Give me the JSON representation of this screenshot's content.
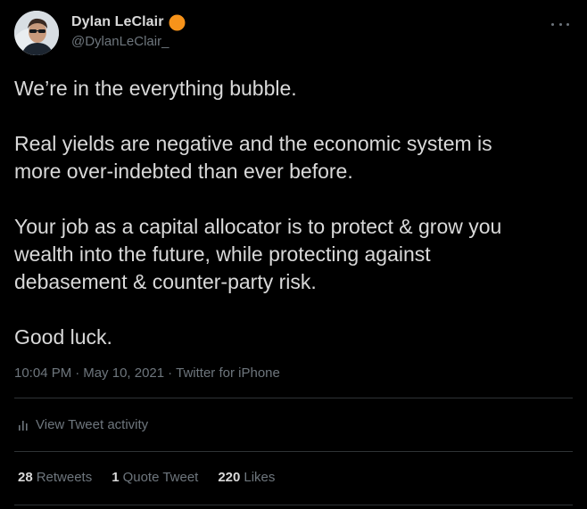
{
  "author": {
    "display_name": "Dylan LeClair",
    "handle": "@DylanLeClair_",
    "badge_color": "#f7931a",
    "badge_icon": "orange-circle-badge-icon"
  },
  "tweet": {
    "paragraphs": [
      "We’re in the everything bubble.",
      "Real yields are negative and the economic system is\nmore over-indebted than ever before.",
      "Your job as a capital allocator is to protect & grow you\nwealth into the future, while protecting against\ndebasement & counter-party risk.",
      "Good luck."
    ]
  },
  "meta": {
    "time": "10:04 PM",
    "separator": "·",
    "date": "May 10, 2021",
    "separator2": "·",
    "source": "Twitter for iPhone"
  },
  "activity": {
    "label": "View Tweet activity",
    "icon": "bar-chart-icon"
  },
  "stats": {
    "retweets_count": "28",
    "retweets_label": "Retweets",
    "quotes_count": "1",
    "quotes_label": "Quote Tweet",
    "likes_count": "220",
    "likes_label": "Likes"
  },
  "colors": {
    "background": "#000000",
    "text_primary": "#d9d9d9",
    "text_secondary": "#6e767d",
    "divider": "#2f3336"
  }
}
